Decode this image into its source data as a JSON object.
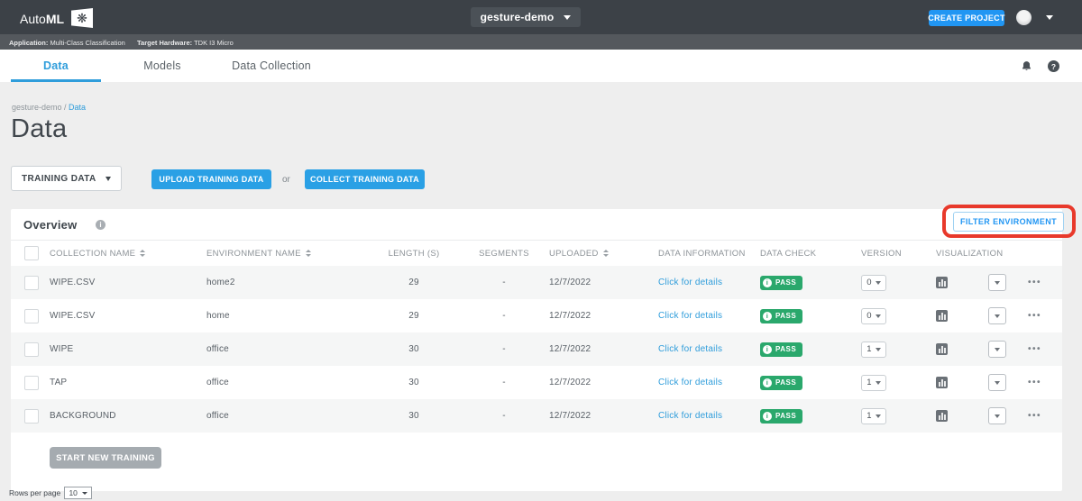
{
  "topbar": {
    "brand_auto": "Auto",
    "brand_ml": "ML",
    "project_selector": "gesture-demo",
    "create_project_label": "CREATE PROJECT"
  },
  "subbar": {
    "application_label": "Application:",
    "application_value": "Multi-Class Classification",
    "hardware_label": "Target Hardware:",
    "hardware_value": "TDK I3 Micro"
  },
  "nav": {
    "tabs": [
      {
        "label": "Data",
        "active": true
      },
      {
        "label": "Models",
        "active": false
      },
      {
        "label": "Data Collection",
        "active": false
      }
    ]
  },
  "breadcrumb": {
    "project": "gesture-demo",
    "separator": " / ",
    "current": "Data"
  },
  "page": {
    "title": "Data"
  },
  "toolbar": {
    "dataset_selector": "TRAINING DATA",
    "upload_button": "UPLOAD TRAINING DATA",
    "or_text": "or",
    "collect_button": "COLLECT TRAINING DATA"
  },
  "overview": {
    "title": "Overview",
    "filter_button": "FILTER ENVIRONMENT"
  },
  "table": {
    "columns": [
      "COLLECTION NAME",
      "ENVIRONMENT NAME",
      "LENGTH (S)",
      "SEGMENTS",
      "UPLOADED",
      "DATA INFORMATION",
      "DATA CHECK",
      "VERSION",
      "VISUALIZATION"
    ],
    "rows": [
      {
        "collection_name": "WIPE.CSV",
        "environment_name": "home2",
        "length_s": "29",
        "segments": "-",
        "uploaded": "12/7/2022",
        "data_information": "Click for details",
        "data_check": "PASS",
        "version": "0"
      },
      {
        "collection_name": "WIPE.CSV",
        "environment_name": "home",
        "length_s": "29",
        "segments": "-",
        "uploaded": "12/7/2022",
        "data_information": "Click for details",
        "data_check": "PASS",
        "version": "0"
      },
      {
        "collection_name": "WIPE",
        "environment_name": "office",
        "length_s": "30",
        "segments": "-",
        "uploaded": "12/7/2022",
        "data_information": "Click for details",
        "data_check": "PASS",
        "version": "1"
      },
      {
        "collection_name": "TAP",
        "environment_name": "office",
        "length_s": "30",
        "segments": "-",
        "uploaded": "12/7/2022",
        "data_information": "Click for details",
        "data_check": "PASS",
        "version": "1"
      },
      {
        "collection_name": "BACKGROUND",
        "environment_name": "office",
        "length_s": "30",
        "segments": "-",
        "uploaded": "12/7/2022",
        "data_information": "Click for details",
        "data_check": "PASS",
        "version": "1"
      }
    ],
    "start_training_button": "START NEW TRAINING"
  },
  "pagination": {
    "label": "Rows per page",
    "value": "10"
  },
  "colors": {
    "topbar_bg": "#3c4147",
    "accent_blue": "#2196f3",
    "link_blue": "#2f9ddb",
    "pass_green": "#2aa86c",
    "annotation_red": "#e8392b"
  }
}
